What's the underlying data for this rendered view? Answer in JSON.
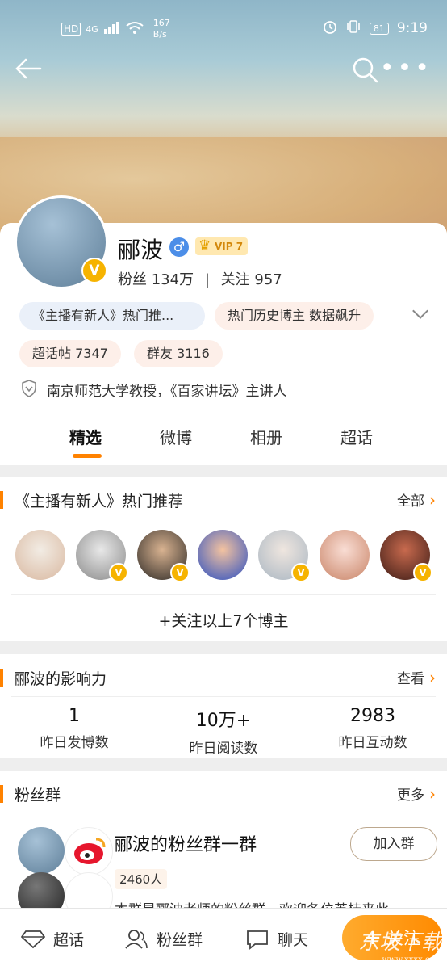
{
  "status_bar": {
    "network": "HD",
    "signal": "4G",
    "speed_value": "167",
    "speed_unit": "B/s",
    "battery": "81",
    "time": "9:19"
  },
  "profile": {
    "name": "郦波",
    "vip_label": "VIP 7",
    "fans_label": "粉丝",
    "fans_count": "134万",
    "separator": "|",
    "following_label": "关注",
    "following_count": "957",
    "tags": [
      "《主播有新人》热门推...",
      "热门历史博主 数据飙升",
      "超话帖 7347",
      "群友 3116"
    ],
    "description": "南京师范大学教授，《百家讲坛》主讲人"
  },
  "tabs": [
    "精选",
    "微博",
    "相册",
    "超话"
  ],
  "recommend": {
    "title": "《主播有新人》热门推荐",
    "more": "全部",
    "follow_all": "+关注以上7个博主"
  },
  "influence": {
    "title": "郦波的影响力",
    "more": "查看",
    "metrics": [
      {
        "value": "1",
        "label": "昨日发博数"
      },
      {
        "value": "10万+",
        "label": "昨日阅读数"
      },
      {
        "value": "2983",
        "label": "昨日互动数"
      }
    ]
  },
  "fan_group": {
    "title": "粉丝群",
    "more": "更多",
    "group_name": "郦波的粉丝群一群",
    "member_count": "2460人",
    "join": "加入群",
    "intro": "本群是郦波老师的粉丝群，欢迎各位英桂来此"
  },
  "bottom_bar": {
    "topic": "超话",
    "fan_group": "粉丝群",
    "chat": "聊天",
    "follow": "关注"
  },
  "watermark": {
    "text": "东坡下载",
    "sub": "www.xxxx.com"
  },
  "colors": {
    "accent": "#ff8200",
    "verified": "#f6b300"
  }
}
